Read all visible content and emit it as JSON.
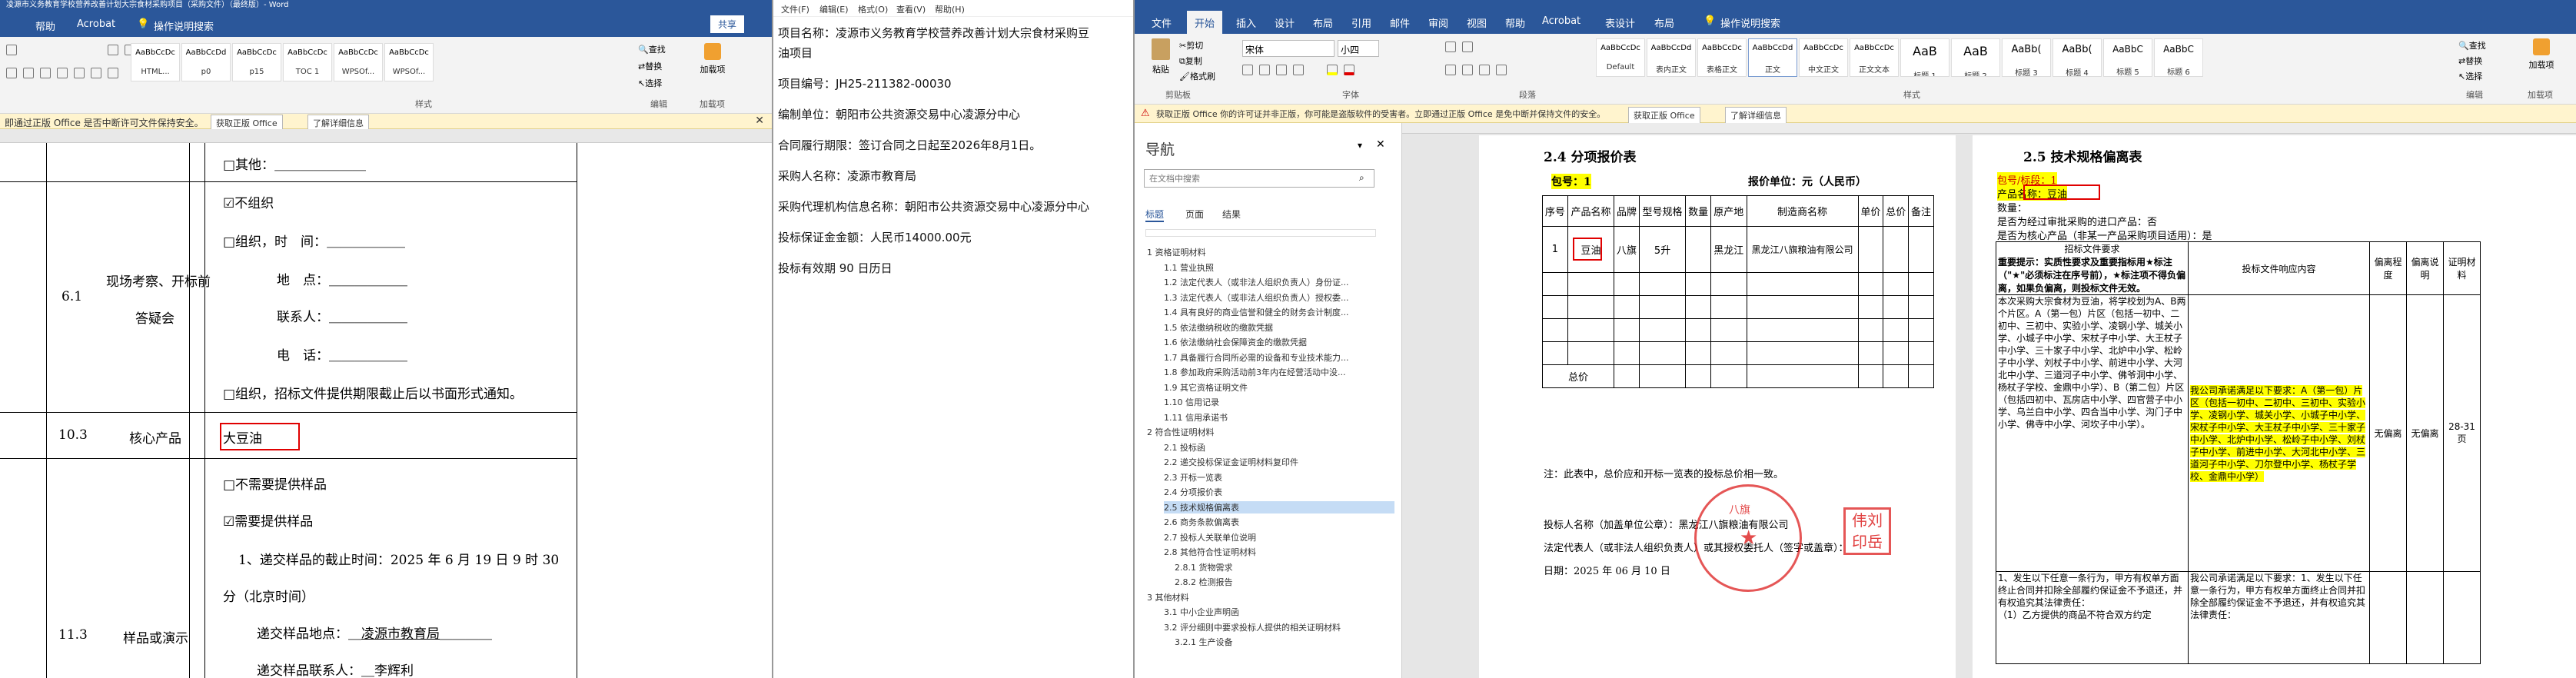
{
  "colors": {
    "word_blue": "#2b579a",
    "stamp_red": "#dc1e1e",
    "highlight": "#ffff00",
    "ribbon": "#f3f3f3"
  },
  "left_window": {
    "title": "凌源市义务教育学校营养改善计划大宗食材采购项目（采购文件）（最终版）- Word",
    "tabs": [
      "帮助",
      "Acrobat",
      "操作说明搜索"
    ],
    "share_label": "共享",
    "style_gallery": [
      {
        "sample": "AaBbCcDc",
        "name": "HTML..."
      },
      {
        "sample": "AaBbCcDd",
        "name": "p0"
      },
      {
        "sample": "AaBbCcDc",
        "name": "p15"
      },
      {
        "sample": "AaBbCcDc",
        "name": "TOC 1"
      },
      {
        "sample": "AaBbCcDc",
        "name": "WPSOf..."
      },
      {
        "sample": "AaBbCcDc",
        "name": "WPSOf..."
      }
    ],
    "edit_items": [
      "查找",
      "替换",
      "选择"
    ],
    "addin_label": "加载项",
    "group_labels": {
      "styles": "样式",
      "editing": "编辑",
      "addins": "加载项"
    },
    "message": "即通过正版 Office 是否中断许可文件保持安全。",
    "message_btn1": "获取正版 Office",
    "message_btn2": "了解详细信息",
    "rows": {
      "other_line": "□其他：",
      "item61_num": "6.1",
      "item61_label1": "现场考察、开标前",
      "item61_label2": "答疑会",
      "no_org": "☑不组织",
      "org": "□组织，时　间：",
      "place": "地　点：",
      "contact": "联系人：",
      "phone": "电　话：",
      "org_note": "□组织，招标文件提供期限截止后以书面形式通知。",
      "item103_num": "10.3",
      "item103_label": "核心产品",
      "item103_value": "大豆油",
      "item113_num": "11.3",
      "item113_label": "样品或演示",
      "no_sample": "□不需要提供样品",
      "need_sample": "☑需要提供样品",
      "deadline": "1、递交样品的截止时间：2025 年 6 月 19 日 9 时 30",
      "deadline2": "分（北京时间）",
      "place_label": "递交样品地点：",
      "place_value": "凌源市教育局",
      "receiver": "递交样品联系人：",
      "receiver_value": "李辉利"
    }
  },
  "middle_window": {
    "menu": [
      "文件(F)",
      "编辑(E)",
      "格式(O)",
      "查看(V)",
      "帮助(H)"
    ],
    "lines": [
      "项目名称：凌源市义务教育学校营养改善计划大宗食材采购豆",
      "油项目",
      "项目编号：JH25-211382-00030",
      "编制单位：朝阳市公共资源交易中心凌源分中心",
      "合同履行期限：签订合同之日起至2026年8月1日。",
      "采购人名称：凌源市教育局",
      "采购代理机构信息名称：朝阳市公共资源交易中心凌源分中心",
      "投标保证金金额：人民币14000.00元",
      "投标有效期 90 日历日"
    ]
  },
  "right_window": {
    "title": "",
    "tabs": [
      "文件",
      "开始",
      "插入",
      "设计",
      "布局",
      "引用",
      "邮件",
      "审阅",
      "视图",
      "帮助",
      "Acrobat",
      "表设计",
      "布局",
      "操作说明搜索"
    ],
    "font_name": "宋体",
    "font_size": "小四",
    "paste_label": "粘贴",
    "clipboard_items": [
      "剪切",
      "复制",
      "格式刷"
    ],
    "style_gallery": [
      {
        "sample": "AaBbCcDc",
        "name": "Default"
      },
      {
        "sample": "AaBbCcDd",
        "name": "表内正文"
      },
      {
        "sample": "AaBbCcDc",
        "name": "表格正文"
      },
      {
        "sample": "AaBbCcDd",
        "name": "正文"
      },
      {
        "sample": "AaBbCcDc",
        "name": "中文正文"
      },
      {
        "sample": "AaBbCcDc",
        "name": "正文文本"
      },
      {
        "sample": "AaB",
        "name": "标题 1"
      },
      {
        "sample": "AaB",
        "name": "标题 2"
      },
      {
        "sample": "AaBb(",
        "name": "标题 3"
      },
      {
        "sample": "AaBb(",
        "name": "标题 4"
      },
      {
        "sample": "AaBbC",
        "name": "标题 5"
      },
      {
        "sample": "AaBbC",
        "name": "标题 6"
      }
    ],
    "edit_items": [
      "查找",
      "替换",
      "选择"
    ],
    "addin_label": "加载项",
    "group_labels": {
      "clipboard": "剪贴板",
      "font": "字体",
      "paragraph": "段落",
      "styles": "样式",
      "editing": "编辑",
      "addins": "加载项"
    },
    "message": "获取正版 Office  你的许可证并非正版，你可能是盗版软件的受害者。立即通过正版 Office 是免中断并保持文件的安全。",
    "message_btn1": "获取正版 Office",
    "message_btn2": "了解详细信息",
    "nav": {
      "title": "导航",
      "search_placeholder": "在文档中搜索",
      "tabs": [
        "标题",
        "页面",
        "结果"
      ],
      "items": [
        "1 资格证明材料",
        "1.1 营业执照",
        "1.2 法定代表人（或非法人组织负责人）身份证...",
        "1.3 法定代表人（或非法人组织负责人）授权委...",
        "1.4 具有良好的商业信誉和健全的财务会计制度...",
        "1.5 依法缴纳税收的缴款凭据",
        "1.6 依法缴纳社会保障资金的缴款凭据",
        "1.7 具备履行合同所必需的设备和专业技术能力...",
        "1.8 参加政府采购活动前3年内在经营活动中没...",
        "1.9 其它资格证明文件",
        "1.10 信用记录",
        "1.11 信用承诺书",
        "2 符合性证明材料",
        "2.1 投标函",
        "2.2 递交投标保证金证明材料复印件",
        "2.3 开标一览表",
        "2.4 分项报价表",
        "2.5 技术规格偏离表",
        "2.6 商务条款偏离表",
        "2.7 投标人关联单位说明",
        "2.8 其他符合性证明材料",
        "2.8.1 货物需求",
        "2.8.2 检测报告",
        "3 其他材料",
        "3.1 中小企业声明函",
        "3.2 评分细则中要求投标人提供的相关证明材料",
        "3.2.1 生产设备"
      ],
      "selected_index": 17
    },
    "page1": {
      "heading": "2.4 分项报价表",
      "package": "包号：1",
      "unit": "报价单位：元（人民币）",
      "headers": [
        "序号",
        "产品名称",
        "品牌",
        "型号规格",
        "数量",
        "原产地",
        "制造商名称",
        "单价",
        "总价",
        "备注"
      ],
      "row1": [
        "1",
        "豆油",
        "八旗",
        "5升",
        "",
        "黑龙江",
        "黑龙江八旗粮油有限公司",
        "",
        "",
        ""
      ],
      "total_label": "总价",
      "note": "注：此表中，总价应和开标一览表的投标总价相一致。",
      "bidder": "投标人名称（加盖单位公章）：黑龙江八旗粮油有限公司",
      "rep": "法定代表人（或非法人组织负责人）或其授权委托人（签字或盖章）：",
      "date": "日期：2025 年 06 月 10 日",
      "stamp_text": "八旗",
      "seal_text": "伟刘印岳"
    },
    "page2": {
      "heading": "2.5 技术规格偏离表",
      "package": "包号/标段：1",
      "product": "产品名称：豆油",
      "qty": "数量：",
      "imported": "是否为经过审批采购的进口产品：否",
      "core": "是否为核心产品（非某一产品采购项目适用）：是",
      "col1": "招标文件要求",
      "col2": "投标文件响应内容",
      "col3": "偏离程度",
      "col4": "偏离说明",
      "col5": "证明材料",
      "important": "重要提示：实质性要求及重要指标用★标注（\"★\"必须标注在序号前），★标注项不得负偏离，如果负偏离，则投标文件无效。",
      "req_text": "本次采购大宗食材为豆油，将学校划为A、B两个片区。A（第一包）片区（包括一初中、二初中、三初中、实验小学、凌钢小学、城关小学、小城子中小学、宋杖子中小学、大王杖子中小学、三十家子中小学、北炉中小学、松岭子中小学、刘杖子中小学、前进中小学、大河北中小学、三道河子中小学、佛爷洞中小学、杨杖子学校、金鼎中小学）、B（第二包）片区（包括四初中、瓦房店中小学、四官营子中小学、乌兰白中小学、四合当中小学、沟门子中小学、佛寺中小学、河坎子中小学）。",
      "resp_text": "我公司承诺满足以下要求：A（第一包）片区（包括一初中、二初中、三初中、实验小学、凌钢小学、城关小学、小城子中小学、宋杖子中小学、大王杖子中小学、三十家子中小学、北炉中小学、松岭子中小学、刘杖子中小学、前进中小学、大河北中小学、三道河子中小学、刀尔登中小学、杨杖子学校、金鼎中小学）",
      "dev1": "无偏离",
      "dev2": "无偏离",
      "pages": "28-31页",
      "req2": "1、发生以下任意一条行为，甲方有权单方面终止合同并扣除全部履约保证金不予退还，并有权追究其法律责任：",
      "req2b": "（1）乙方提供的商品不符合双方约定",
      "resp2": "我公司承诺满足以下要求：1、发生以下任意一条行为，甲方有权单方面终止合同并扣除全部履约保证金不予退还，并有权追究其法律责任："
    }
  }
}
